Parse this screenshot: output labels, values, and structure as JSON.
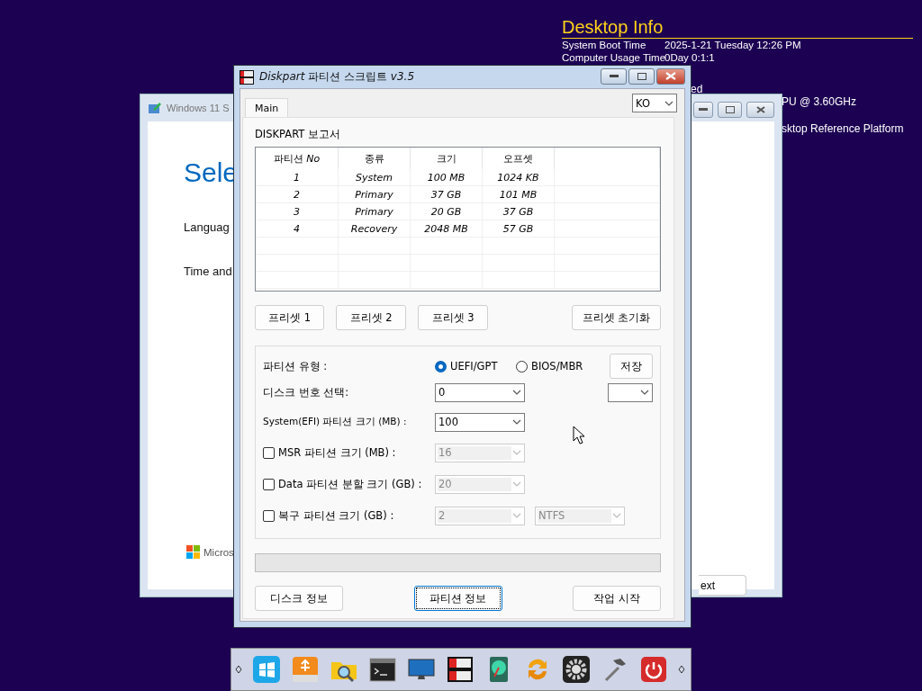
{
  "desktop_info": {
    "title": "Desktop Info",
    "rows": [
      {
        "label": "System Boot Time",
        "value": "2025-1-21 Tuesday 12:26 PM"
      },
      {
        "label": "Computer Usage Time",
        "value": "0Day 0:1:1"
      }
    ],
    "fragments": [
      "ed",
      "PU @ 3.60GHz",
      "sktop Reference Platform"
    ]
  },
  "background_window": {
    "title": "Windows 11 S",
    "heading": "Sele",
    "labels": [
      "Languag",
      "Time and"
    ],
    "logo_text": "Micros",
    "button": "ext"
  },
  "window": {
    "title": "*Diskpart* 파티션 스크립트 *v3.5*",
    "tabs": [
      {
        "label": "Main",
        "selected": true
      }
    ],
    "language": "KO",
    "report_title": "DISKPART 보고서",
    "table": {
      "columns": [
        "파티션 *No*",
        "종류",
        "크기",
        "오프셋"
      ],
      "rows": [
        [
          "1",
          "System",
          "100 MB",
          "1024 KB"
        ],
        [
          "2",
          "Primary",
          "37 GB",
          "101 MB"
        ],
        [
          "3",
          "Primary",
          "20 GB",
          "37 GB"
        ],
        [
          "4",
          "Recovery",
          "2048 MB",
          "57 GB"
        ]
      ]
    },
    "presets": [
      "프리셋 1",
      "프리셋 2",
      "프리셋 3"
    ],
    "preset_reset": "프리셋 초기화",
    "partition_type": {
      "label": "파티션 유형 :",
      "options": [
        {
          "label": "UEFI/GPT",
          "selected": true
        },
        {
          "label": "BIOS/MBR",
          "selected": false
        }
      ]
    },
    "save_button": "저장",
    "settings": [
      {
        "kind": "combo",
        "label": "디스크 번호 선택:",
        "value": "0",
        "disabled": false
      },
      {
        "kind": "combo",
        "label": "System(EFI) 파티션 크기 (MB) :",
        "value": "100",
        "disabled": false
      },
      {
        "kind": "check",
        "label": "MSR 파티션 크기 (MB) :",
        "checked": false,
        "value": "16",
        "disabled": true
      },
      {
        "kind": "check",
        "label": "Data 파티션 분할 크기 (GB) :",
        "checked": false,
        "value": "20",
        "disabled": true
      },
      {
        "kind": "check",
        "label": "복구 파티션 크기 (GB) :",
        "checked": false,
        "value": "2",
        "disabled": true,
        "extra_value": "NTFS"
      }
    ],
    "progress": {
      "level": 0
    },
    "buttons": [
      {
        "label": "디스크 정보",
        "focused": false
      },
      {
        "label": "파티션 정보",
        "focused": true
      },
      {
        "label": "작업 시작",
        "focused": false
      }
    ]
  }
}
